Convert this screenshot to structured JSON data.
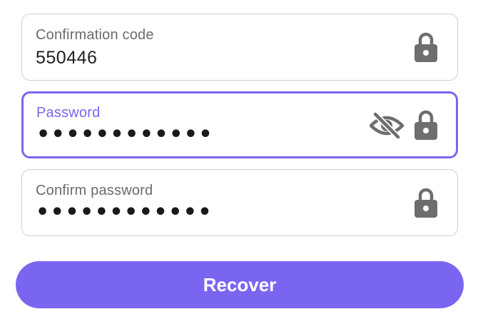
{
  "form": {
    "confirmation_code": {
      "label": "Confirmation code",
      "value": "550446",
      "icon": "lock-icon"
    },
    "password": {
      "label": "Password",
      "value": "••••••••••••",
      "focused": true,
      "visibility_icon": "eye-slash-icon",
      "icon": "lock-icon"
    },
    "confirm_password": {
      "label": "Confirm password",
      "value": "••••••••••••",
      "icon": "lock-icon"
    },
    "submit_label": "Recover"
  },
  "colors": {
    "accent": "#7B66F0",
    "button": "#7A65F0",
    "border": "#CFCFCF",
    "label": "#6B6B6B",
    "icon": "#6E6E6E"
  }
}
